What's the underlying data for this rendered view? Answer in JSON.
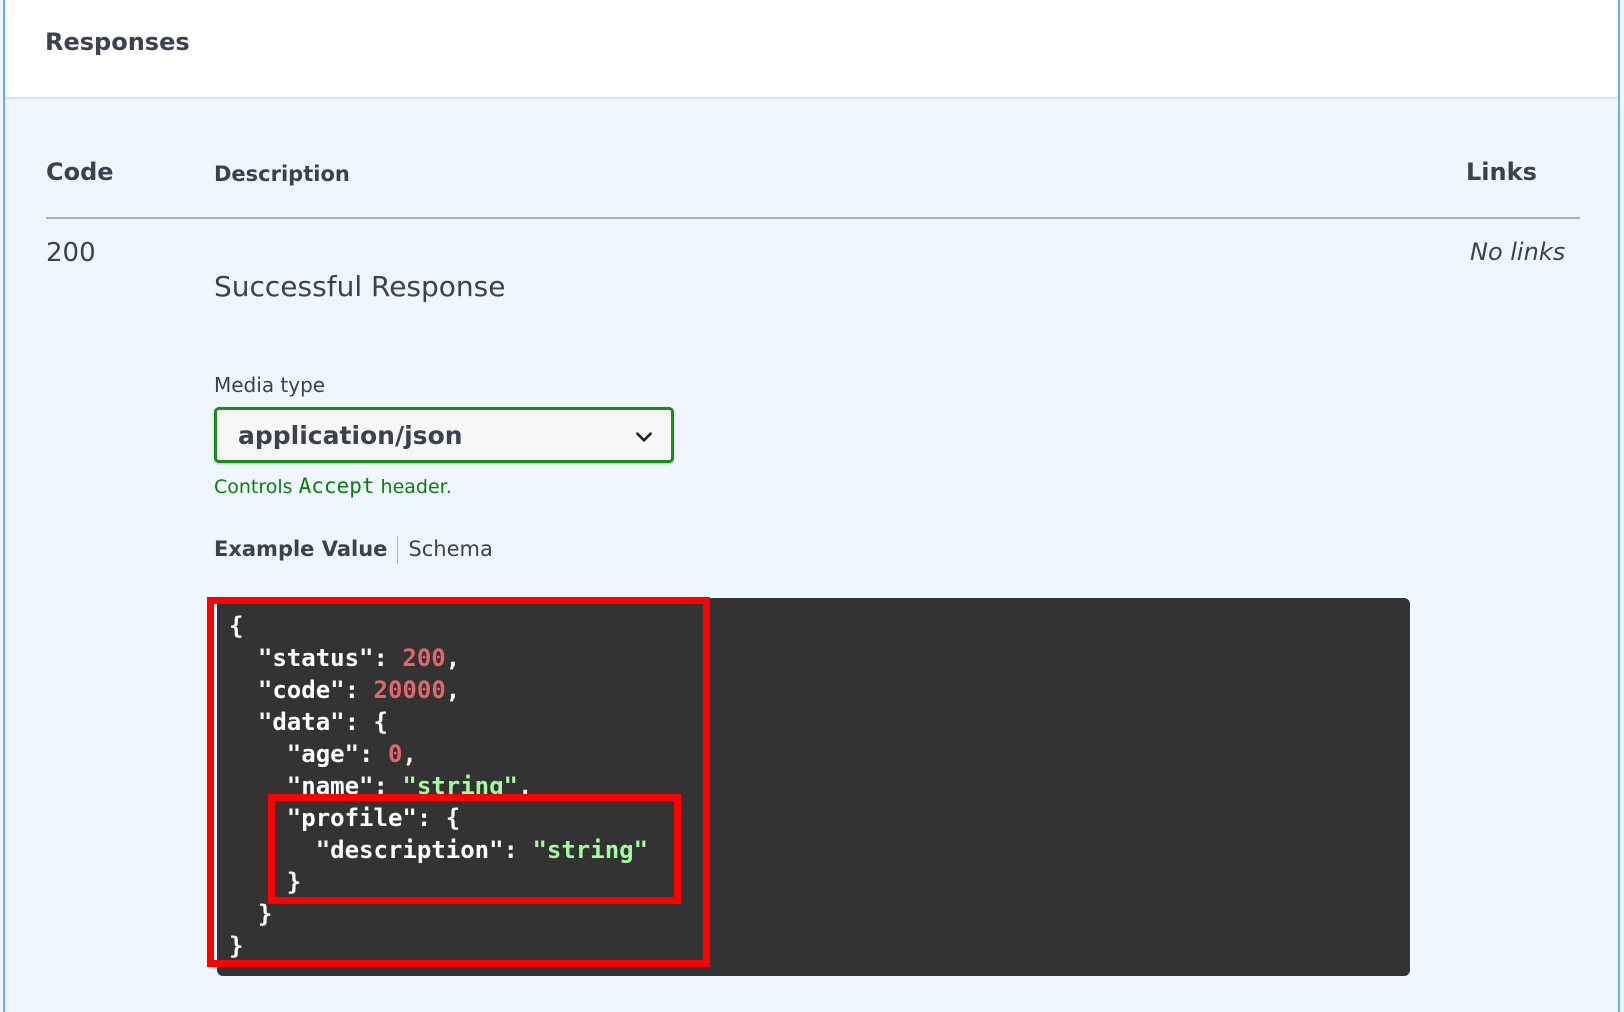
{
  "section": {
    "title": "Responses"
  },
  "table": {
    "headers": {
      "code": "Code",
      "description": "Description",
      "links": "Links"
    },
    "rows": [
      {
        "code": "200",
        "description": "Successful Response",
        "links": "No links",
        "media_type_label": "Media type",
        "media_type_value": "application/json",
        "controls_prefix": "Controls ",
        "controls_code": "Accept",
        "controls_suffix": " header.",
        "tabs": [
          "Example Value",
          "Schema"
        ],
        "example_lines": [
          "{",
          "  \"status\": 200,",
          "  \"code\": 20000,",
          "  \"data\": {",
          "    \"age\": 0,",
          "    \"name\": \"string\",",
          "    \"profile\": {",
          "      \"description\": \"string\"",
          "    }",
          "  }",
          "}"
        ]
      }
    ]
  },
  "colors": {
    "accent_border": "#61affe",
    "select_border": "#1a8a1a",
    "highlight": "#ff0000",
    "code_bg": "#333333",
    "number": "#e06868",
    "string": "#a2fca2"
  }
}
